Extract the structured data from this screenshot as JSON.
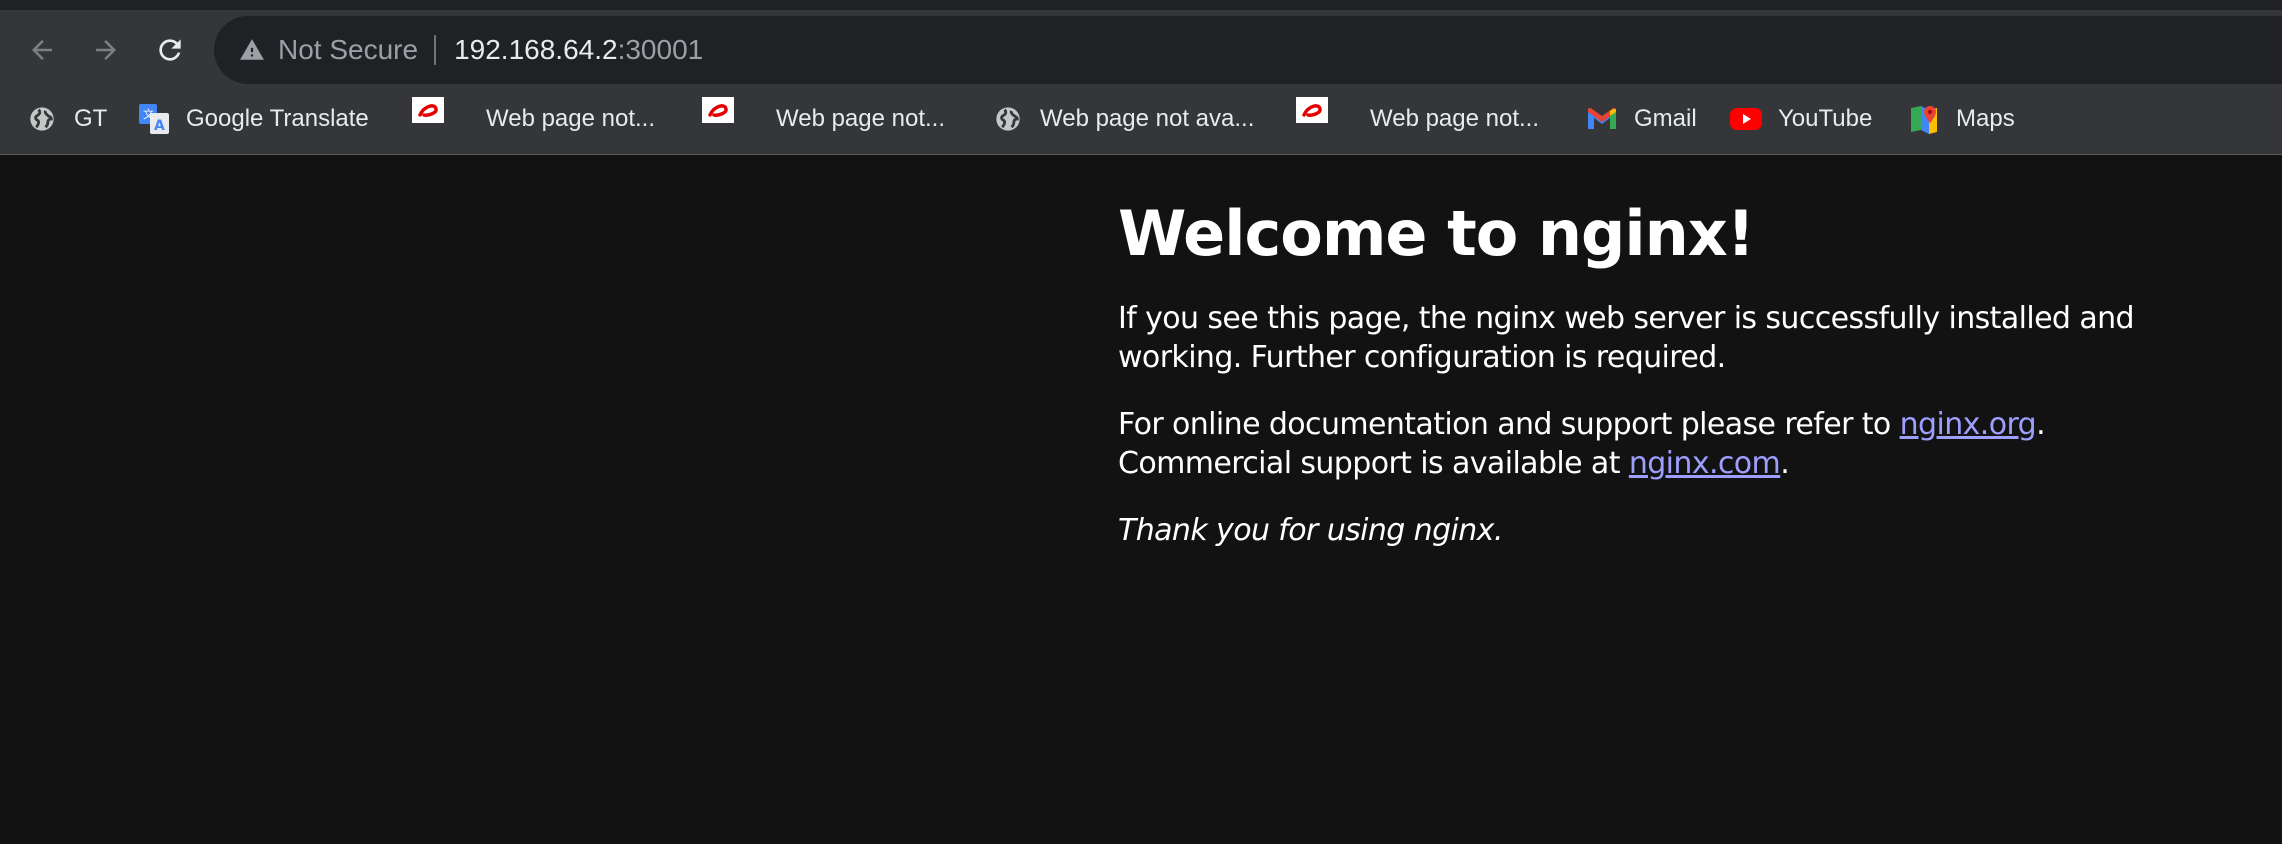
{
  "toolbar": {
    "back_icon": "arrow-left-icon",
    "forward_icon": "arrow-right-icon",
    "reload_icon": "reload-icon"
  },
  "omnibox": {
    "warning_icon": "warning-triangle-icon",
    "security_label": "Not Secure",
    "url_host": "192.168.64.2",
    "url_port": ":30001"
  },
  "bookmarks": [
    {
      "label": "GT",
      "icon": "globe-icon"
    },
    {
      "label": "Google Translate",
      "icon": "google-translate-icon"
    },
    {
      "label": "Web page not...",
      "icon": "airtel-icon"
    },
    {
      "label": "Web page not...",
      "icon": "airtel-icon"
    },
    {
      "label": "Web page not ava...",
      "icon": "globe-icon"
    },
    {
      "label": "Web page not...",
      "icon": "airtel-icon"
    },
    {
      "label": "Gmail",
      "icon": "gmail-icon"
    },
    {
      "label": "YouTube",
      "icon": "youtube-icon"
    },
    {
      "label": "Maps",
      "icon": "google-maps-icon"
    }
  ],
  "page": {
    "heading": "Welcome to nginx!",
    "para1": "If you see this page, the nginx web server is successfully installed and working. Further configuration is required.",
    "para2_prefix": "For online documentation and support please refer to ",
    "link_org": "nginx.org",
    "para2_mid": ".",
    "para2_line2": "Commercial support is available at ",
    "link_com": "nginx.com",
    "para2_suffix": ".",
    "thanks": "Thank you for using nginx."
  },
  "colors": {
    "page_background": "#121212",
    "chrome_toolbar": "#35363a",
    "omnibox_background": "#202124",
    "link": "#9e9eff"
  }
}
